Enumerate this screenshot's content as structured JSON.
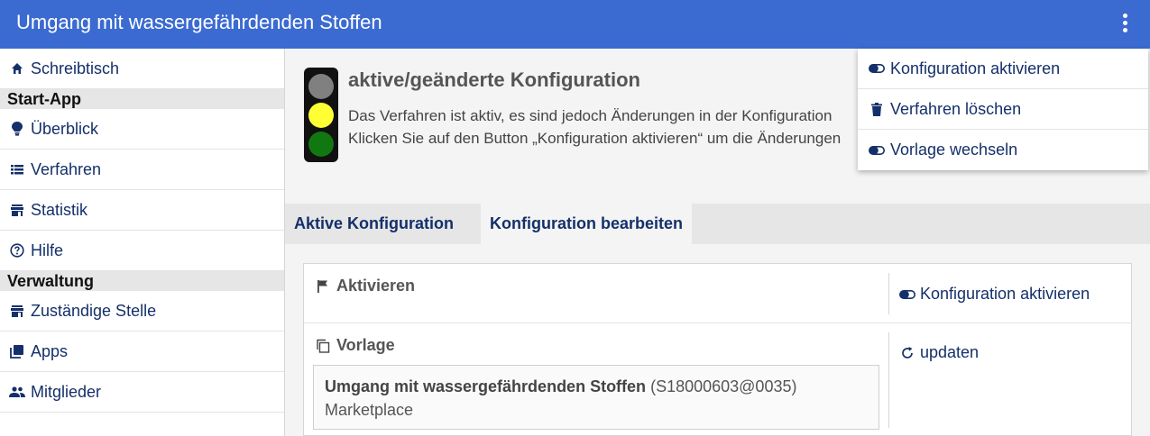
{
  "app": {
    "title": "Umgang mit wassergefährdenden Stoffen"
  },
  "sidebar": {
    "items": [
      {
        "label": "Schreibtisch",
        "icon": "home-icon"
      },
      {
        "section": "Start-App"
      },
      {
        "label": "Überblick",
        "icon": "lightbulb-icon"
      },
      {
        "label": "Verfahren",
        "icon": "list-icon"
      },
      {
        "label": "Statistik",
        "icon": "store-icon"
      },
      {
        "label": "Hilfe",
        "icon": "help-circle-icon"
      },
      {
        "section": "Verwaltung"
      },
      {
        "label": "Zuständige Stelle",
        "icon": "store-icon"
      },
      {
        "label": "Apps",
        "icon": "library-icon"
      },
      {
        "label": "Mitglieder",
        "icon": "people-icon"
      }
    ]
  },
  "status": {
    "headline": "aktive/geänderte Konfiguration",
    "message_line1": "Das Verfahren ist aktiv, es sind jedoch Änderungen in der Konfiguration",
    "message_line2": "Klicken Sie auf den Button „Konfiguration aktivieren“ um die Änderungen",
    "traffic_light": {
      "red": "#808080",
      "yellow": "#ffff33",
      "green": "#117711"
    }
  },
  "tabs": [
    {
      "label": "Aktive Konfiguration",
      "active": false
    },
    {
      "label": "Konfiguration bearbeiten",
      "active": true
    }
  ],
  "panel": {
    "activate": {
      "label": "Aktivieren",
      "action": "Konfiguration aktivieren"
    },
    "template": {
      "label": "Vorlage",
      "action": "updaten",
      "name": "Umgang mit wassergefährdenden Stoffen",
      "code": "(S18000603@0035)",
      "source": "Marketplace"
    }
  },
  "dropdown": {
    "items": [
      {
        "label": "Konfiguration aktivieren",
        "icon": "toggle-icon"
      },
      {
        "label": "Verfahren löschen",
        "icon": "trash-icon"
      },
      {
        "label": "Vorlage wechseln",
        "icon": "toggle-icon"
      }
    ]
  },
  "colors": {
    "header": "#3b6bd1",
    "link": "#14306a"
  }
}
